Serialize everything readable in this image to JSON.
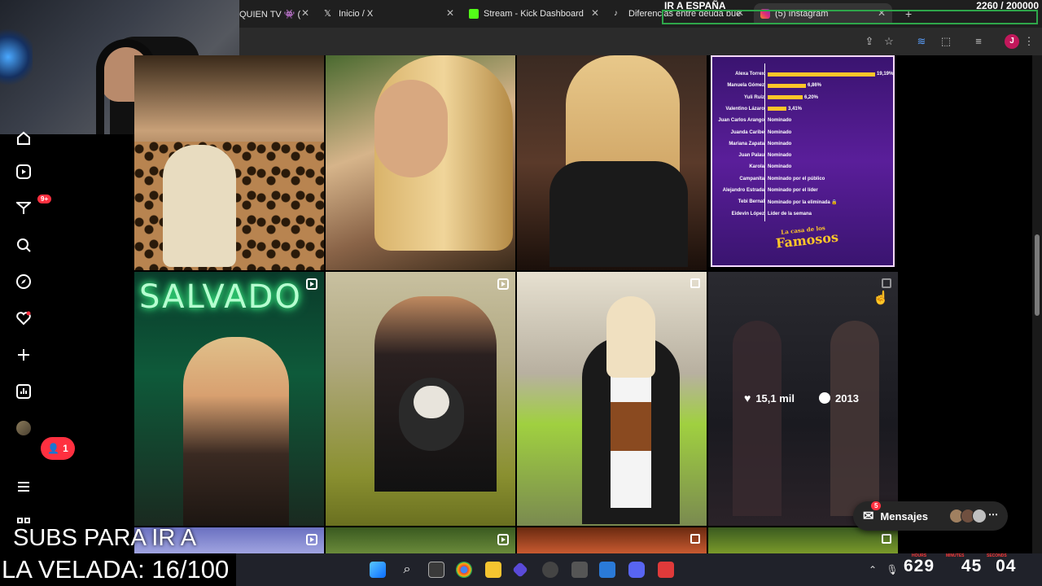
{
  "browser": {
    "tabs": [
      {
        "label": "QUIEN TV 👾 (",
        "icon": "twitch-icon"
      },
      {
        "label": "Inicio / X",
        "icon": "x-logo-icon"
      },
      {
        "label": "Stream - Kick Dashboard",
        "icon": "kick-icon"
      },
      {
        "label": "Diferencias entre deuda bue",
        "icon": "tiktok-icon"
      },
      {
        "label": "(5) Instagram",
        "icon": "instagram-icon",
        "active": true
      }
    ],
    "avatar_letter": "J"
  },
  "stream_overlay": {
    "goal_title": "IR A ESPAÑA",
    "goal_counter": "2260 / 200000",
    "accent": "#2ea64a",
    "subs_line1": "SUBS PARA IR A",
    "subs_line2": "LA VELADA: 16/100",
    "timer": {
      "hours": "629",
      "minutes": "45",
      "seconds": "04",
      "label_hours": "HOURS",
      "label_minutes": "MINUTES",
      "label_seconds": "SECONDS"
    }
  },
  "sidebar": {
    "items": [
      {
        "name": "home",
        "icon": "home-icon"
      },
      {
        "name": "reels",
        "icon": "reels-icon"
      },
      {
        "name": "messages",
        "icon": "messenger-icon",
        "badge": "9+"
      },
      {
        "name": "search",
        "icon": "search-icon"
      },
      {
        "name": "explore",
        "icon": "compass-icon"
      },
      {
        "name": "notifications",
        "icon": "heart-icon"
      },
      {
        "name": "create",
        "icon": "plus-icon"
      },
      {
        "name": "dashboard",
        "icon": "dashboard-icon"
      },
      {
        "name": "profile",
        "icon": "avatar-icon"
      },
      {
        "name": "more",
        "icon": "menu-icon"
      },
      {
        "name": "apps",
        "icon": "apps-icon"
      }
    ],
    "notification_count": "1"
  },
  "poll": {
    "rows": [
      {
        "name": "Alexa Torrex",
        "value": "19,19%",
        "pct": 19.19
      },
      {
        "name": "Manuela Gómez",
        "value": "6,86%",
        "pct": 6.86
      },
      {
        "name": "Yuli Ruiz",
        "value": "6,20%",
        "pct": 6.2
      },
      {
        "name": "Valentino Lázaro",
        "value": "3,41%",
        "pct": 3.41
      },
      {
        "name": "Juan Carlos Arango",
        "status": "Nominado"
      },
      {
        "name": "Juanda Caribe",
        "status": "Nominado"
      },
      {
        "name": "Mariana Zapata",
        "status": "Nominado"
      },
      {
        "name": "Juan Palau",
        "status": "Nominado"
      },
      {
        "name": "Karola",
        "status": "Nominado"
      },
      {
        "name": "Campanita",
        "status": "Nominado por el público"
      },
      {
        "name": "Alejandro Estrada",
        "status": "Nominado por el líder"
      },
      {
        "name": "Tebi Bernal",
        "status": "Nominado por la eliminada 🔒"
      },
      {
        "name": "Eidevin López",
        "status": "Líder de la semana"
      }
    ],
    "logo_line1": "La casa de los",
    "logo_line2": "Famosos"
  },
  "grid": {
    "neon_text": "SALVADO",
    "hover_stats": {
      "likes": "15,1 mil",
      "comments": "2013"
    }
  },
  "messages_pill": {
    "label": "Mensajes",
    "badge": "5"
  }
}
